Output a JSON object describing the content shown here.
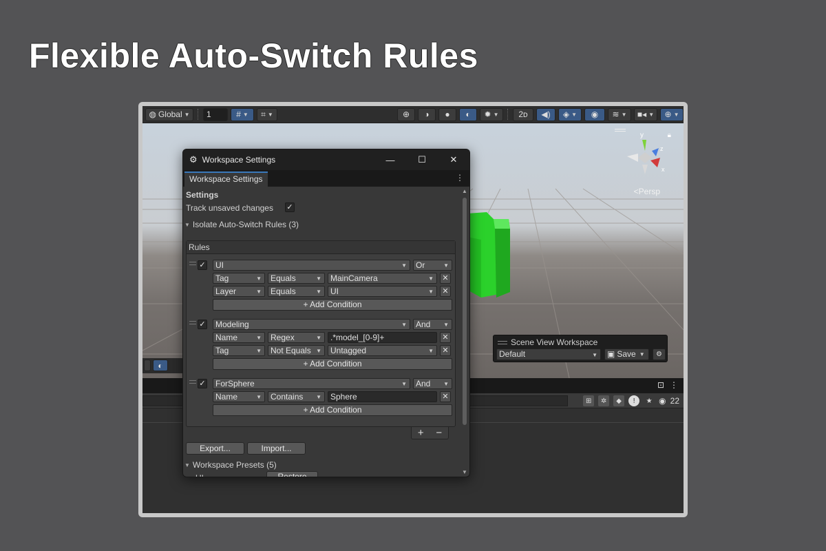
{
  "headline": "Flexible Auto-Switch Rules",
  "toolbar": {
    "global_label": "Global",
    "grid_value": "1"
  },
  "scene": {
    "persp_label": "<Persp",
    "gizmo_y": "y",
    "gizmo_z": "z",
    "gizmo_x": "x"
  },
  "scene_view_workspace": {
    "title": "Scene View Workspace",
    "selected": "Default",
    "save_label": "Save"
  },
  "bottom": {
    "count": "22"
  },
  "window": {
    "title": "Workspace Settings",
    "tab_label": "Workspace Settings",
    "settings_heading": "Settings",
    "track_unsaved_label": "Track unsaved changes",
    "track_unsaved_checked": true,
    "rules_foldout": "Isolate Auto-Switch Rules (3)",
    "rules_header": "Rules",
    "add_condition_label": "+ Add Condition",
    "rules": [
      {
        "enabled": true,
        "name": "UI",
        "logic": "Or",
        "conditions": [
          {
            "field": "Tag",
            "op": "Equals",
            "value": "MainCamera",
            "value_is_dropdown": true
          },
          {
            "field": "Layer",
            "op": "Equals",
            "value": "UI",
            "value_is_dropdown": true
          }
        ]
      },
      {
        "enabled": true,
        "name": "Modeling",
        "logic": "And",
        "conditions": [
          {
            "field": "Name",
            "op": "Regex",
            "value": ".*model_[0-9]+",
            "value_is_dropdown": false
          },
          {
            "field": "Tag",
            "op": "Not Equals",
            "value": "Untagged",
            "value_is_dropdown": true
          }
        ]
      },
      {
        "enabled": true,
        "name": "ForSphere",
        "logic": "And",
        "conditions": [
          {
            "field": "Name",
            "op": "Contains",
            "value": "Sphere",
            "value_is_dropdown": false
          }
        ]
      }
    ],
    "plus_label": "+",
    "minus_label": "−",
    "export_label": "Export...",
    "import_label": "Import...",
    "presets_foldout": "Workspace Presets (5)",
    "preset_first_name": "UI",
    "restore_label": "Restore"
  }
}
